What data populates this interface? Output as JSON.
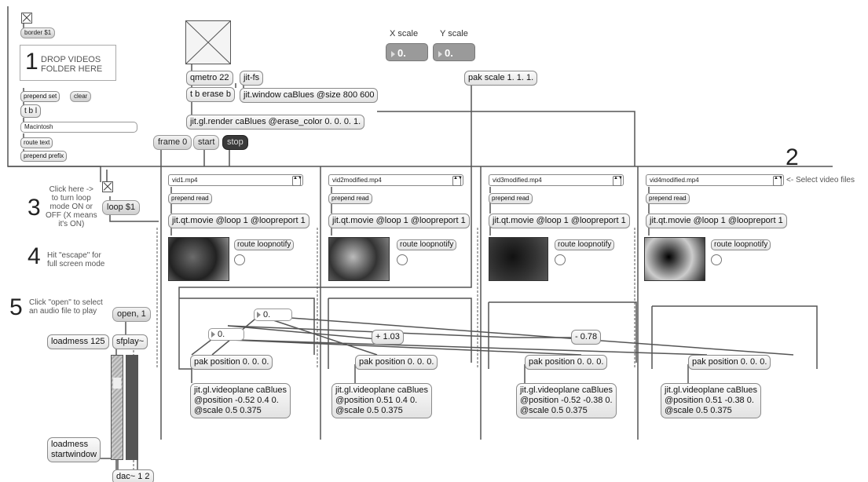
{
  "dropzone": {
    "number": "1",
    "line1": "DROP VIDEOS",
    "line2": "FOLDER HERE"
  },
  "top_left": {
    "border_msg": "border $1",
    "prepend_set": "prepend set",
    "clear": "clear",
    "tbl": "t b l",
    "path_text": "Macintosh",
    "route_text": "route text",
    "prepend_prefix": "prepend prefix"
  },
  "render_chain": {
    "qmetro": "qmetro 22",
    "jitfs": "jit-fs",
    "tb_erase": "t b erase b",
    "jitwindow": "jit.window caBlues @size 800 600",
    "jitrender": "jit.gl.render caBlues @erase_color 0. 0. 0. 1."
  },
  "transport": {
    "frame0": "frame 0",
    "start": "start",
    "stop": "stop"
  },
  "scale": {
    "x_label": "X scale",
    "y_label": "Y scale",
    "x_value": "0.",
    "y_value": "0.",
    "pak_scale": "pak scale 1. 1. 1."
  },
  "instructions": {
    "step2_num": "2",
    "step2_text": "<- Select video files",
    "step3_num": "3",
    "step3_text": "Click here ->\nto turn loop\nmode ON or\nOFF (X means\nit's ON)",
    "step4_num": "4",
    "step4_text": "Hit \"escape\" for\nfull screen mode",
    "step5_num": "5",
    "step5_text": "Click \"open\" to select\nan audio file to play",
    "loop_msg": "loop $1"
  },
  "channels": [
    {
      "file": "vid1.mp4",
      "prepend_read": "prepend read",
      "movie": "jit.qt.movie @loop 1 @loopreport 1",
      "route": "route loopnotify",
      "pak_position": "pak position 0. 0. 0.",
      "videoplane": "jit.gl.videoplane caBlues\n@position -0.52 0.4 0.\n@scale 0.5 0.375"
    },
    {
      "file": "vid2modified.mp4",
      "prepend_read": "prepend read",
      "movie": "jit.qt.movie @loop 1 @loopreport 1",
      "route": "route loopnotify",
      "pak_position": "pak position 0. 0. 0.",
      "videoplane": "jit.gl.videoplane caBlues\n@position 0.51 0.4 0.\n@scale 0.5 0.375"
    },
    {
      "file": "vid3modified.mp4",
      "prepend_read": "prepend read",
      "movie": "jit.qt.movie @loop 1 @loopreport 1",
      "route": "route loopnotify",
      "pak_position": "pak position 0. 0. 0.",
      "videoplane": "jit.gl.videoplane caBlues\n@position -0.52 -0.38 0.\n@scale 0.5 0.375"
    },
    {
      "file": "vid4modified.mp4",
      "prepend_read": "prepend read",
      "movie": "jit.qt.movie @loop 1 @loopreport 1",
      "route": "route loopnotify",
      "pak_position": "pak position 0. 0. 0.",
      "videoplane": "jit.gl.videoplane caBlues\n@position 0.51 -0.38 0.\n@scale 0.5 0.375"
    }
  ],
  "math": {
    "num_a": "0.",
    "num_b": "0.",
    "plus": "+ 1.03",
    "minus": "- 0.78"
  },
  "audio": {
    "open": "open, 1",
    "loadmess125": "loadmess 125",
    "sfplay": "sfplay~",
    "loadmess_start": "loadmess\nstartwindow",
    "dac": "dac~ 1 2"
  }
}
